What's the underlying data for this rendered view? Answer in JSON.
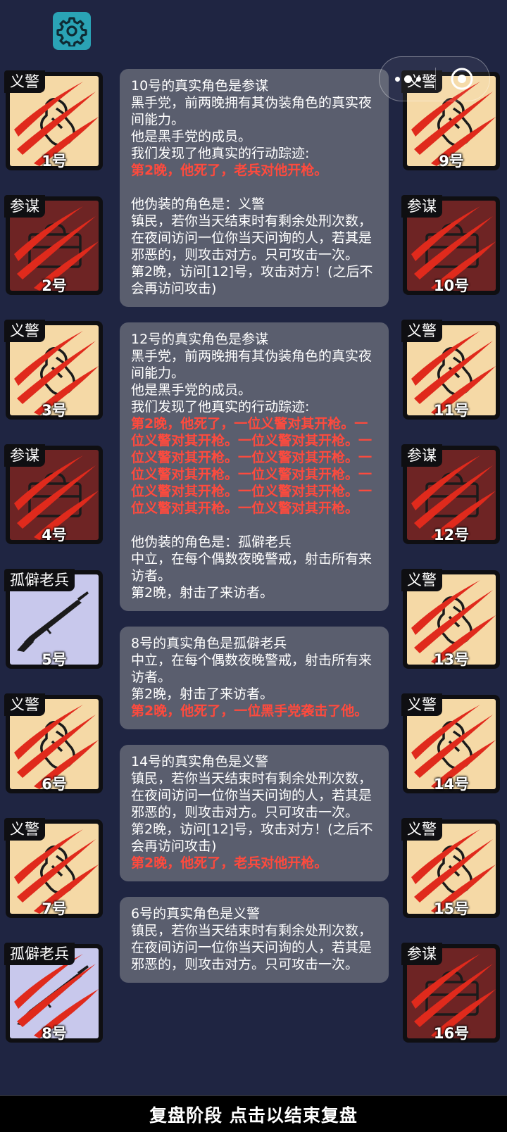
{
  "settings": {
    "icon": "gear-icon"
  },
  "capsule": {
    "more_icon": "more-dots-icon",
    "close_icon": "close-circle-icon"
  },
  "colors": {
    "background": "#1f2542",
    "vigilante": "#f5d9a6",
    "consigliere": "#6e2424",
    "veteran": "#c8c8ec",
    "alert_text": "#ff4a3d",
    "message_bg": "#5a5e6e"
  },
  "players_left": [
    {
      "role": "义警",
      "number": "1号",
      "type": "vig",
      "dead": true
    },
    {
      "role": "参谋",
      "number": "2号",
      "type": "con",
      "dead": true
    },
    {
      "role": "义警",
      "number": "3号",
      "type": "vig",
      "dead": true
    },
    {
      "role": "参谋",
      "number": "4号",
      "type": "con",
      "dead": true
    },
    {
      "role": "孤僻老兵",
      "number": "5号",
      "type": "vet",
      "dead": false
    },
    {
      "role": "义警",
      "number": "6号",
      "type": "vig",
      "dead": true
    },
    {
      "role": "义警",
      "number": "7号",
      "type": "vig",
      "dead": true
    },
    {
      "role": "孤僻老兵",
      "number": "8号",
      "type": "vet",
      "dead": true
    }
  ],
  "players_right": [
    {
      "role": "义警",
      "number": "9号",
      "type": "vig",
      "dead": true
    },
    {
      "role": "参谋",
      "number": "10号",
      "type": "con",
      "dead": true
    },
    {
      "role": "义警",
      "number": "11号",
      "type": "vig",
      "dead": true
    },
    {
      "role": "参谋",
      "number": "12号",
      "type": "con",
      "dead": true
    },
    {
      "role": "义警",
      "number": "13号",
      "type": "vig",
      "dead": true
    },
    {
      "role": "义警",
      "number": "14号",
      "type": "vig",
      "dead": true
    },
    {
      "role": "义警",
      "number": "15号",
      "type": "vig",
      "dead": true
    },
    {
      "role": "参谋",
      "number": "16号",
      "type": "con",
      "dead": true
    }
  ],
  "messages": [
    {
      "lines": [
        {
          "text": "10号的真实角色是参谋",
          "style": "normal"
        },
        {
          "text": "黑手党，前两晚拥有其伪装角色的真实夜间能力。",
          "style": "normal"
        },
        {
          "text": "他是黑手党的成员。",
          "style": "normal"
        },
        {
          "text": "我们发现了他真实的行动踪迹:",
          "style": "normal"
        },
        {
          "text": "第2晚，他死了，老兵对他开枪。",
          "style": "red"
        },
        {
          "text": "",
          "style": "gap"
        },
        {
          "text": "他伪装的角色是：义警",
          "style": "normal"
        },
        {
          "text": "镇民，若你当天结束时有剩余处刑次数，在夜间访问一位你当天问询的人，若其是邪恶的，则攻击对方。只可攻击一次。",
          "style": "normal"
        },
        {
          "text": "第2晚，访问[12]号，攻击对方！(之后不会再访问攻击)",
          "style": "normal"
        }
      ]
    },
    {
      "lines": [
        {
          "text": "12号的真实角色是参谋",
          "style": "normal"
        },
        {
          "text": "黑手党，前两晚拥有其伪装角色的真实夜间能力。",
          "style": "normal"
        },
        {
          "text": "他是黑手党的成员。",
          "style": "normal"
        },
        {
          "text": "我们发现了他真实的行动踪迹:",
          "style": "normal"
        },
        {
          "text": "第2晚，他死了，一位义警对其开枪。一位义警对其开枪。一位义警对其开枪。一位义警对其开枪。一位义警对其开枪。一位义警对其开枪。一位义警对其开枪。一位义警对其开枪。一位义警对其开枪。一位义警对其开枪。一位义警对其开枪。",
          "style": "red"
        },
        {
          "text": "",
          "style": "gap"
        },
        {
          "text": "他伪装的角色是：孤僻老兵",
          "style": "normal"
        },
        {
          "text": "中立，在每个偶数夜晚警戒，射击所有来访者。",
          "style": "normal"
        },
        {
          "text": "第2晚，射击了来访者。",
          "style": "normal"
        }
      ]
    },
    {
      "lines": [
        {
          "text": "8号的真实角色是孤僻老兵",
          "style": "normal"
        },
        {
          "text": "中立，在每个偶数夜晚警戒，射击所有来访者。",
          "style": "normal"
        },
        {
          "text": "第2晚，射击了来访者。",
          "style": "normal"
        },
        {
          "text": "第2晚，他死了，一位黑手党袭击了他。",
          "style": "red"
        }
      ]
    },
    {
      "lines": [
        {
          "text": "14号的真实角色是义警",
          "style": "normal"
        },
        {
          "text": "镇民，若你当天结束时有剩余处刑次数，在夜间访问一位你当天问询的人，若其是邪恶的，则攻击对方。只可攻击一次。",
          "style": "normal"
        },
        {
          "text": "第2晚，访问[12]号，攻击对方！(之后不会再访问攻击)",
          "style": "normal"
        },
        {
          "text": "第2晚，他死了，老兵对他开枪。",
          "style": "red"
        }
      ]
    },
    {
      "lines": [
        {
          "text": "6号的真实角色是义警",
          "style": "normal"
        },
        {
          "text": "镇民，若你当天结束时有剩余处刑次数，在夜间访问一位你当天问询的人，若其是邪恶的，则攻击对方。只可攻击一次。",
          "style": "normal"
        }
      ]
    }
  ],
  "bottom_bar": {
    "label": "复盘阶段 点击以结束复盘"
  }
}
